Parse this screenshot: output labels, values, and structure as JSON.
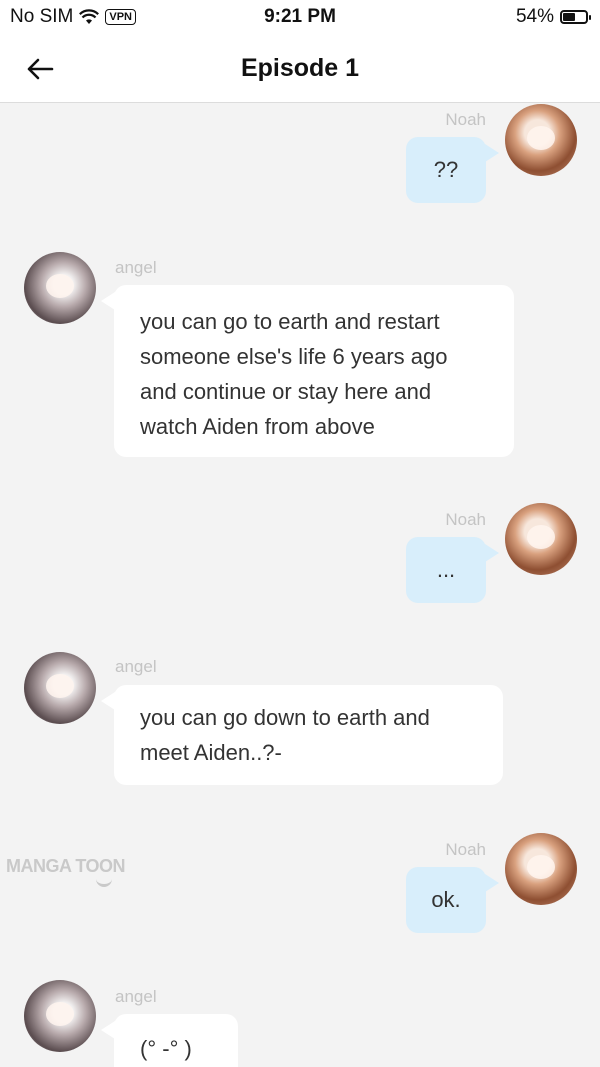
{
  "status_bar": {
    "carrier": "No SIM",
    "vpn": "VPN",
    "time": "9:21 PM",
    "battery": "54%",
    "battery_level": 0.54
  },
  "header": {
    "title": "Episode 1"
  },
  "messages": [
    {
      "sender": "Noah",
      "text": "??"
    },
    {
      "sender": "angel",
      "lines": [
        "you can go to earth and restart",
        "someone else's life 6 years ago",
        "and continue or stay here and",
        "watch Aiden from above"
      ]
    },
    {
      "sender": "Noah",
      "text": "..."
    },
    {
      "sender": "angel",
      "lines": [
        "you can go down to earth and",
        "meet Aiden..?-"
      ]
    },
    {
      "sender": "Noah",
      "text": "ok."
    },
    {
      "sender": "angel",
      "text": "(°  -°  )"
    }
  ],
  "watermark": "MANGA TOON"
}
